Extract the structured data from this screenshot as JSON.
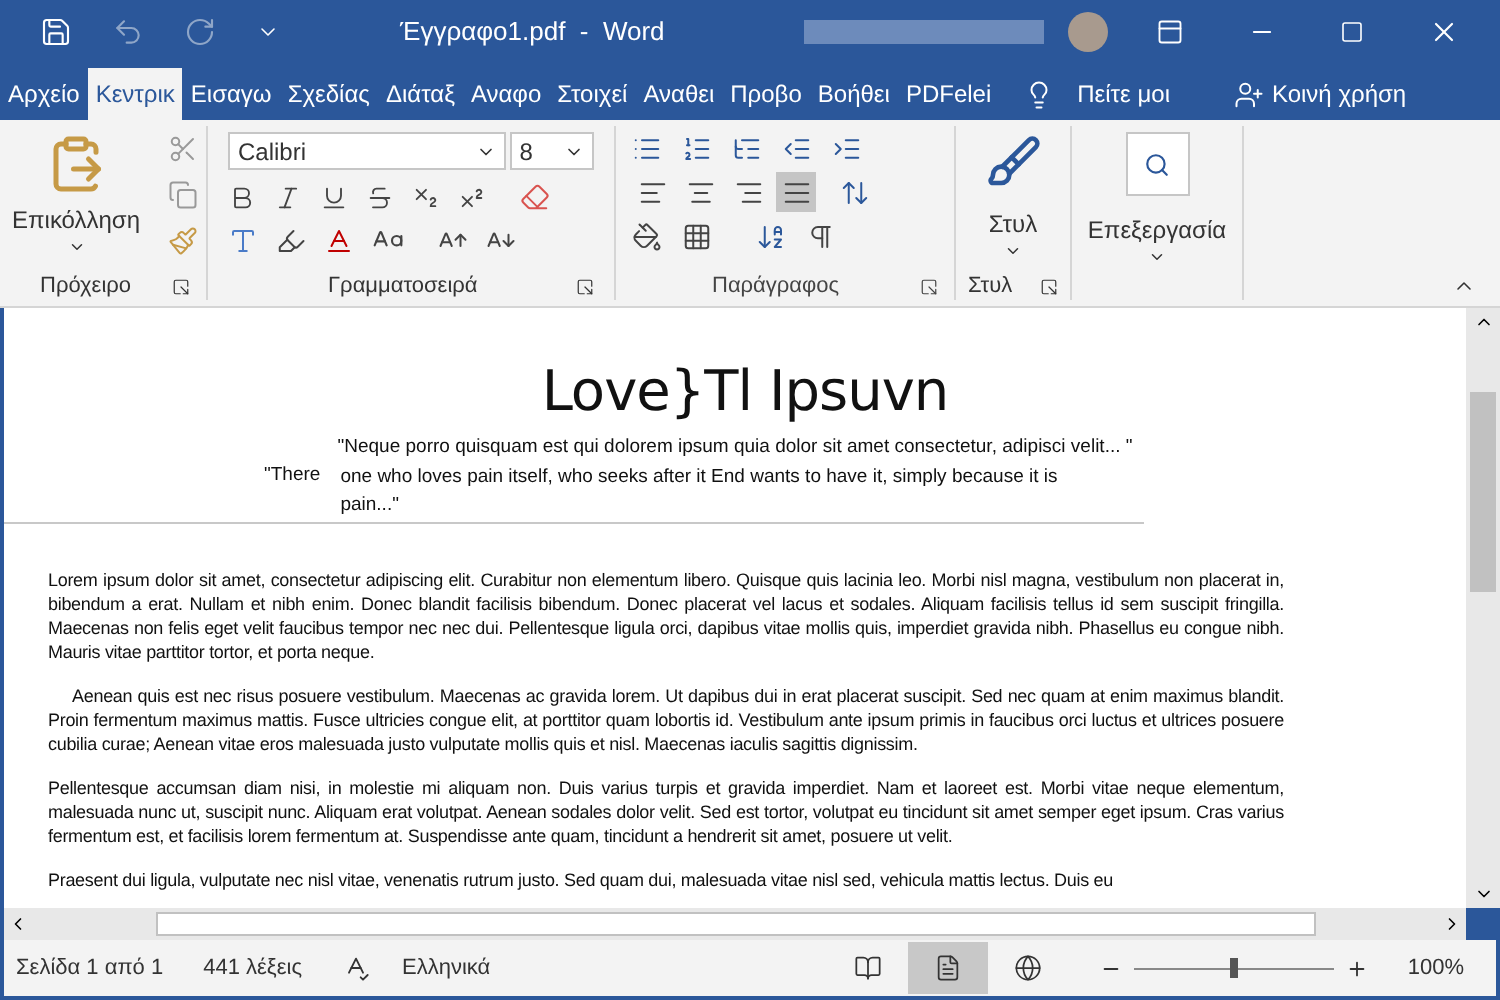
{
  "window": {
    "title": "Έγγραφο1.pdf  -  Word"
  },
  "tabs": [
    {
      "label": "Αρχείο",
      "selected": false
    },
    {
      "label": "Κεντρικ",
      "selected": true
    },
    {
      "label": "Εισαγω",
      "selected": false
    },
    {
      "label": "Σχεδίας",
      "selected": false
    },
    {
      "label": "Διάταξ",
      "selected": false
    },
    {
      "label": "Αναφο",
      "selected": false
    },
    {
      "label": "Στοιχεί",
      "selected": false
    },
    {
      "label": "Αναθει",
      "selected": false
    },
    {
      "label": "Προβο",
      "selected": false
    },
    {
      "label": "Βοήθει",
      "selected": false
    },
    {
      "label": "PDFelei",
      "selected": false
    }
  ],
  "tell_me": "Πείτε μοι",
  "share": "Κοινή χρήση",
  "ribbon": {
    "clipboard": {
      "paste": "Επικόλληση",
      "group": "Πρόχειρο"
    },
    "font": {
      "name": "Calibri",
      "size": "8",
      "group": "Γραμματοσειρά"
    },
    "paragraph": {
      "group": "Παράγραφος",
      "alignments": [
        {
          "kind": "left",
          "selected": false
        },
        {
          "kind": "center",
          "selected": false
        },
        {
          "kind": "right",
          "selected": false
        },
        {
          "kind": "justify",
          "selected": true
        }
      ]
    },
    "styles": {
      "button": "Στυλ",
      "group": "Στυλ"
    },
    "editing": {
      "button": "Επεξεργασία"
    }
  },
  "document": {
    "title": "Love}Tl Ipsuvn",
    "quote_1": "\"Neque porro quisquam est qui dolorem ipsum quia dolor sit amet consectetur, adipisci velit... \"",
    "quote_2_start": "\"There",
    "quote_2": "one who loves pain itself, who seeks after it End wants to have it, simply because it is pain...\"",
    "paragraphs": [
      {
        "first_line_indent": false,
        "text": "Lorem ipsum dolor sit amet, consectetur adipiscing elit. Curabitur non elementum libero. Quisque quis lacinia leo. Morbi nisl magna, vestibulum non placerat in, bibendum a erat. Nullam et nibh enim. Donec blandit facilisis bibendum. Donec placerat vel lacus et sodales. Aliquam facilisis tellus id sem suscipit fringilla. Maecenas non felis eget velit faucibus tempor nec nec dui. Pellentesque ligula orci, dapibus vitae mollis quis, imperdiet gravida nibh. Phasellus eu congue nibh. Mauris vitae parttitor tortor, et porta neque."
      },
      {
        "first_line_indent": true,
        "text": "Aenean quis est nec risus posuere vestibulum. Maecenas ac gravida lorem. Ut dapibus dui in erat placerat suscipit. Sed nec quam at enim maximus blandit. Proin fermentum maximus mattis. Fusce ultricies congue elit, at porttitor quam lobortis id. Vestibulum ante ipsum primis in faucibus orci luctus et ultrices posuere cubilia curae; Aenean vitae eros malesuada justo vulputate mollis quis et nisl. Maecenas iaculis sagittis dignissim."
      },
      {
        "first_line_indent": false,
        "text": "Pellentesque accumsan diam nisi, in molestie mi aliquam non. Duis varius turpis et gravida imperdiet. Nam et laoreet est. Morbi vitae neque elementum, malesuada nunc ut, suscipit nunc. Aliquam erat volutpat. Aenean sodales dolor velit. Sed est tortor, volutpat eu tincidunt sit amet semper eget ipsum. Cras varius fermentum est, et facilisis lorem fermentum at. Suspendisse ante quam, tincidunt a hendrerit sit amet, posuere ut velit."
      },
      {
        "first_line_indent": false,
        "text": "Praesent dui ligula, vulputate nec nisl vitae, venenatis rutrum justo. Sed quam dui, malesuada vitae nisl sed, vehicula mattis lectus. Duis eu"
      }
    ]
  },
  "status_bar": {
    "page": "Σελίδα 1 από 1",
    "words": "441 λέξεις",
    "language": "Ελληνικά",
    "views": [
      {
        "kind": "read",
        "selected": false
      },
      {
        "kind": "print",
        "selected": true
      },
      {
        "kind": "web",
        "selected": false
      }
    ],
    "zoom": {
      "level": 0.5,
      "reading": "100%"
    }
  }
}
